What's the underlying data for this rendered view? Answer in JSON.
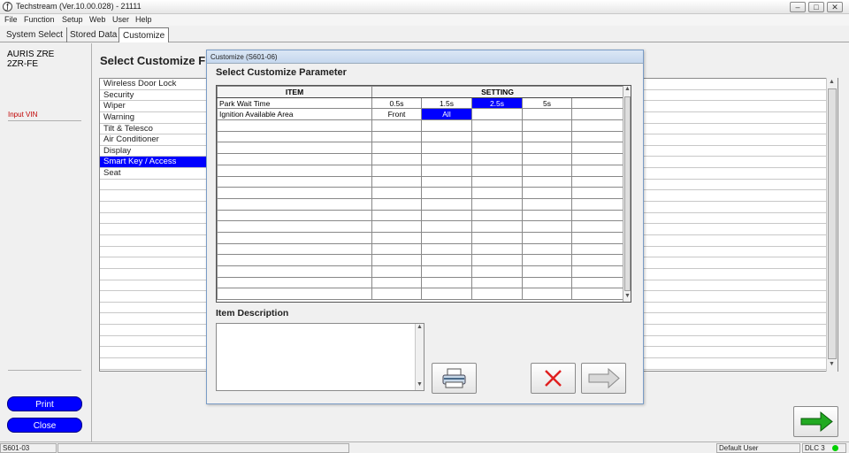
{
  "window": {
    "title": "Techstream (Ver.10.00.028) - 21111",
    "app_icon": "ƒ",
    "controls": [
      "–",
      "□",
      "✕"
    ]
  },
  "menu": [
    "File",
    "Function",
    "Setup",
    "Web",
    "User",
    "Help"
  ],
  "tabs": [
    {
      "label": "System Select",
      "active": false
    },
    {
      "label": "Stored Data",
      "active": false
    },
    {
      "label": "Customize",
      "active": true
    }
  ],
  "vehicle": {
    "model": "AURIS ZRE",
    "engine": "2ZR-FE",
    "vin_label": "Input VIN"
  },
  "left_buttons": {
    "print": "Print",
    "close": "Close"
  },
  "main": {
    "heading": "Select Customize F",
    "categories": [
      {
        "label": "Wireless Door Lock",
        "selected": false
      },
      {
        "label": "Security",
        "selected": false
      },
      {
        "label": "Wiper",
        "selected": false
      },
      {
        "label": "Warning",
        "selected": false
      },
      {
        "label": "Tilt & Telesco",
        "selected": false
      },
      {
        "label": "Air Conditioner",
        "selected": false
      },
      {
        "label": "Display",
        "selected": false
      },
      {
        "label": "Smart Key / Access",
        "selected": true
      },
      {
        "label": "Seat",
        "selected": false
      }
    ]
  },
  "dialog": {
    "title": "Customize (S601-06)",
    "heading": "Select Customize Parameter",
    "columns": {
      "item": "ITEM",
      "setting": "SETTING"
    },
    "rows": [
      {
        "item": "Park Wait Time",
        "settings": [
          "0.5s",
          "1.5s",
          "2.5s",
          "5s",
          ""
        ],
        "selected_index": 2
      },
      {
        "item": "Ignition Available Area",
        "settings": [
          "Front",
          "All",
          "",
          "",
          ""
        ],
        "selected_index": 1
      }
    ],
    "description_heading": "Item Description",
    "description_text": ""
  },
  "statusbar": {
    "code": "S601-03",
    "user": "Default User",
    "connection": "DLC 3"
  },
  "colors": {
    "selection": "#0000ff",
    "button_blue": "#0000ff",
    "led_green": "#00d000",
    "cancel_red": "#e02020",
    "next_green": "#22aa22"
  }
}
